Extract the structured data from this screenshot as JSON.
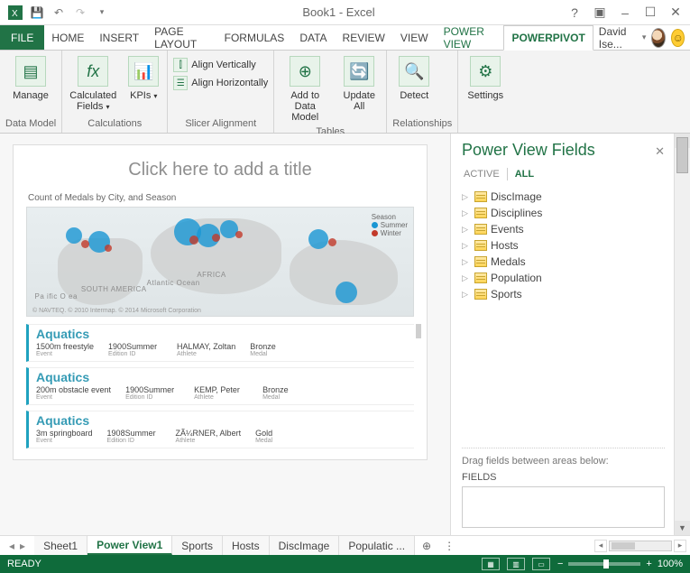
{
  "titlebar": {
    "title": "Book1 - Excel"
  },
  "ribbon_tabs": {
    "file": "FILE",
    "items": [
      "HOME",
      "INSERT",
      "PAGE LAYOUT",
      "FORMULAS",
      "DATA",
      "REVIEW",
      "VIEW",
      "POWER VIEW",
      "POWERPIVOT"
    ],
    "active": "POWERPIVOT",
    "contextual": "POWER VIEW",
    "user": "David Ise..."
  },
  "ribbon": {
    "groups": {
      "data_model": {
        "label": "Data Model",
        "manage": "Manage"
      },
      "calculations": {
        "label": "Calculations",
        "calc_fields": "Calculated Fields",
        "kpis": "KPIs"
      },
      "slicer_alignment": {
        "label": "Slicer Alignment",
        "vert": "Align Vertically",
        "horz": "Align Horizontally"
      },
      "tables": {
        "label": "Tables",
        "add": "Add to Data Model",
        "update": "Update All"
      },
      "relationships": {
        "label": "Relationships",
        "detect": "Detect"
      },
      "settings_grp": {
        "label": "",
        "settings": "Settings"
      }
    }
  },
  "canvas": {
    "title_placeholder": "Click here to add a title",
    "chart_title": "Count of Medals by City, and Season",
    "legend": {
      "title": "Season",
      "summer": "Summer",
      "winter": "Winter"
    },
    "map_labels": {
      "sa": "SOUTH AMERICA",
      "af": "AFRICA",
      "ao": "Atlantic Ocean",
      "po": "Pa ific O ea"
    },
    "attribution": "© NAVTEQ. © 2010 Intermap. © 2014 Microsoft Corporation",
    "cards": [
      {
        "title": "Aquatics",
        "event": "1500m freestyle",
        "event_sub": "Event",
        "edition": "1900Summer",
        "edition_sub": "Edition ID",
        "athlete": "HALMAY, Zoltan",
        "athlete_sub": "Athlete",
        "medal": "Bronze",
        "medal_sub": "Medal"
      },
      {
        "title": "Aquatics",
        "event": "200m obstacle event",
        "event_sub": "Event",
        "edition": "1900Summer",
        "edition_sub": "Edition ID",
        "athlete": "KEMP, Peter",
        "athlete_sub": "Athlete",
        "medal": "Bronze",
        "medal_sub": "Medal"
      },
      {
        "title": "Aquatics",
        "event": "3m springboard",
        "event_sub": "Event",
        "edition": "1908Summer",
        "edition_sub": "Edition ID",
        "athlete": "ZÃ¼RNER, Albert",
        "athlete_sub": "Athlete",
        "medal": "Gold",
        "medal_sub": "Medal"
      }
    ]
  },
  "fields_pane": {
    "title": "Power View Fields",
    "modes": {
      "active": "ACTIVE",
      "all": "ALL"
    },
    "tables": [
      "DiscImage",
      "Disciplines",
      "Events",
      "Hosts",
      "Medals",
      "Population",
      "Sports"
    ],
    "areas_hint": "Drag fields between areas below:",
    "areas_label": "FIELDS"
  },
  "sheet_tabs": {
    "items": [
      "Sheet1",
      "Power View1",
      "Sports",
      "Hosts",
      "DiscImage",
      "Populatic ..."
    ],
    "active": "Power View1"
  },
  "status": {
    "ready": "READY",
    "zoom": "100%"
  }
}
